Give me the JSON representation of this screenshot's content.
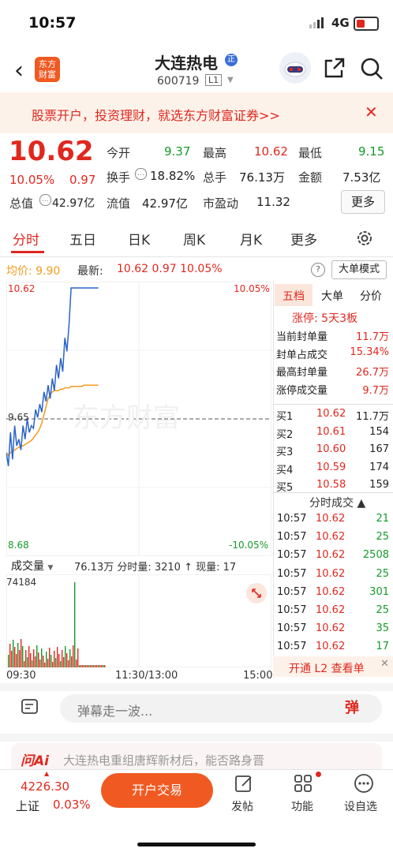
{
  "status": {
    "time": "10:57",
    "network": "4G"
  },
  "header": {
    "name": "大连热电",
    "badge": "正",
    "code": "600719",
    "level": "L1",
    "logo_line1": "东方",
    "logo_line2": "财富"
  },
  "banner": {
    "text": "股票开户，投资理财，就选东方财富证券>>",
    "close": "✕"
  },
  "quote": {
    "price": "10.62",
    "pct": "10.05%",
    "change": "0.97",
    "open_label": "今开",
    "open": "9.37",
    "high_label": "最高",
    "high": "10.62",
    "low_label": "最低",
    "low": "9.15",
    "turnover_label": "换手",
    "turnover": "18.82%",
    "volume_label": "总手",
    "volume": "76.13万",
    "amount_label": "金额",
    "amount": "7.53亿",
    "mktcap_label": "总值",
    "mktcap": "42.97亿",
    "float_label": "流值",
    "float": "42.97亿",
    "pe_label": "市盈动",
    "pe": "11.32",
    "more": "更多"
  },
  "tabs": [
    "分时",
    "五日",
    "日K",
    "周K",
    "月K",
    "更多"
  ],
  "chart_header": {
    "avg": "均价: 9.90",
    "latest_label": "最新:",
    "latest": "10.62  0.97  10.05%",
    "bigorder": "大单模式",
    "help": "?"
  },
  "chart_data": {
    "type": "line",
    "y_left": [
      "10.62",
      "9.65",
      "8.68"
    ],
    "y_right": [
      "10.05%",
      "-10.05%"
    ],
    "x_ticks": [
      "09:30",
      "11:30/13:00",
      "15:00"
    ],
    "watermark": "东方财富",
    "prev_close": 9.65,
    "ylim": [
      8.68,
      10.62
    ],
    "price_series": [
      9.4,
      9.3,
      9.55,
      9.35,
      9.6,
      9.45,
      9.5,
      9.42,
      9.6,
      9.5,
      9.65,
      9.55,
      9.6,
      9.58,
      9.72,
      9.66,
      9.76,
      9.7,
      9.85,
      9.78,
      9.9,
      9.8,
      9.95,
      9.86,
      10.05,
      9.95,
      10.1,
      10.0,
      10.25,
      10.15,
      10.35,
      10.62,
      10.62,
      10.62,
      10.62,
      10.62,
      10.62,
      10.62,
      10.62,
      10.62,
      10.62,
      10.62,
      10.62,
      10.62,
      10.62
    ],
    "avg_series": [
      9.4,
      9.38,
      9.4,
      9.41,
      9.42,
      9.43,
      9.44,
      9.45,
      9.45,
      9.46,
      9.47,
      9.48,
      9.49,
      9.51,
      9.53,
      9.55,
      9.58,
      9.62,
      9.68,
      9.74,
      9.8,
      9.83,
      9.85,
      9.86,
      9.86,
      9.86,
      9.87,
      9.87,
      9.88,
      9.88,
      9.88,
      9.89,
      9.89,
      9.89,
      9.89,
      9.89,
      9.89,
      9.9,
      9.9,
      9.9,
      9.9,
      9.9,
      9.9,
      9.9,
      9.9
    ],
    "volume": {
      "max_label": "74184",
      "label": "成交量",
      "info": "76.13万  分时量: 3210 ↑ 现量: 17"
    }
  },
  "right_panel": {
    "tabs": [
      "五档",
      "大单",
      "分价"
    ],
    "limit_title": "涨停: 5天3板",
    "stats": [
      {
        "label": "当前封单量",
        "value": "11.7万"
      },
      {
        "label": "封单占成交",
        "value": "15.34%"
      },
      {
        "label": "最高封单量",
        "value": "26.7万"
      },
      {
        "label": "涨停成交量",
        "value": "9.7万"
      }
    ],
    "bids": [
      {
        "label": "买1",
        "price": "10.62",
        "vol": "11.7万"
      },
      {
        "label": "买2",
        "price": "10.61",
        "vol": "154"
      },
      {
        "label": "买3",
        "price": "10.60",
        "vol": "167"
      },
      {
        "label": "买4",
        "price": "10.59",
        "vol": "174"
      },
      {
        "label": "买5",
        "price": "10.58",
        "vol": "159"
      }
    ],
    "trades_title": "分时成交 ▲",
    "trades": [
      {
        "t": "10:57",
        "p": "10.62",
        "v": "21"
      },
      {
        "t": "10:57",
        "p": "10.62",
        "v": "25"
      },
      {
        "t": "10:57",
        "p": "10.62",
        "v": "2508"
      },
      {
        "t": "10:57",
        "p": "10.62",
        "v": "25"
      },
      {
        "t": "10:57",
        "p": "10.62",
        "v": "301"
      },
      {
        "t": "10:57",
        "p": "10.62",
        "v": "25"
      },
      {
        "t": "10:57",
        "p": "10.62",
        "v": "35"
      },
      {
        "t": "10:57",
        "p": "10.62",
        "v": "17"
      }
    ],
    "l2": "开通 L2 查看单"
  },
  "comment": {
    "placeholder": "弹幕走一波...",
    "danmu": "弹"
  },
  "ai": {
    "text": "大连热电重组唐辉新材后，能否路身晋"
  },
  "bottom": {
    "index_value": "4226.30",
    "index_name": "上证",
    "index_pct": "0.03%",
    "trade": "开户交易",
    "post": "发帖",
    "func": "功能",
    "settings": "设自选"
  }
}
